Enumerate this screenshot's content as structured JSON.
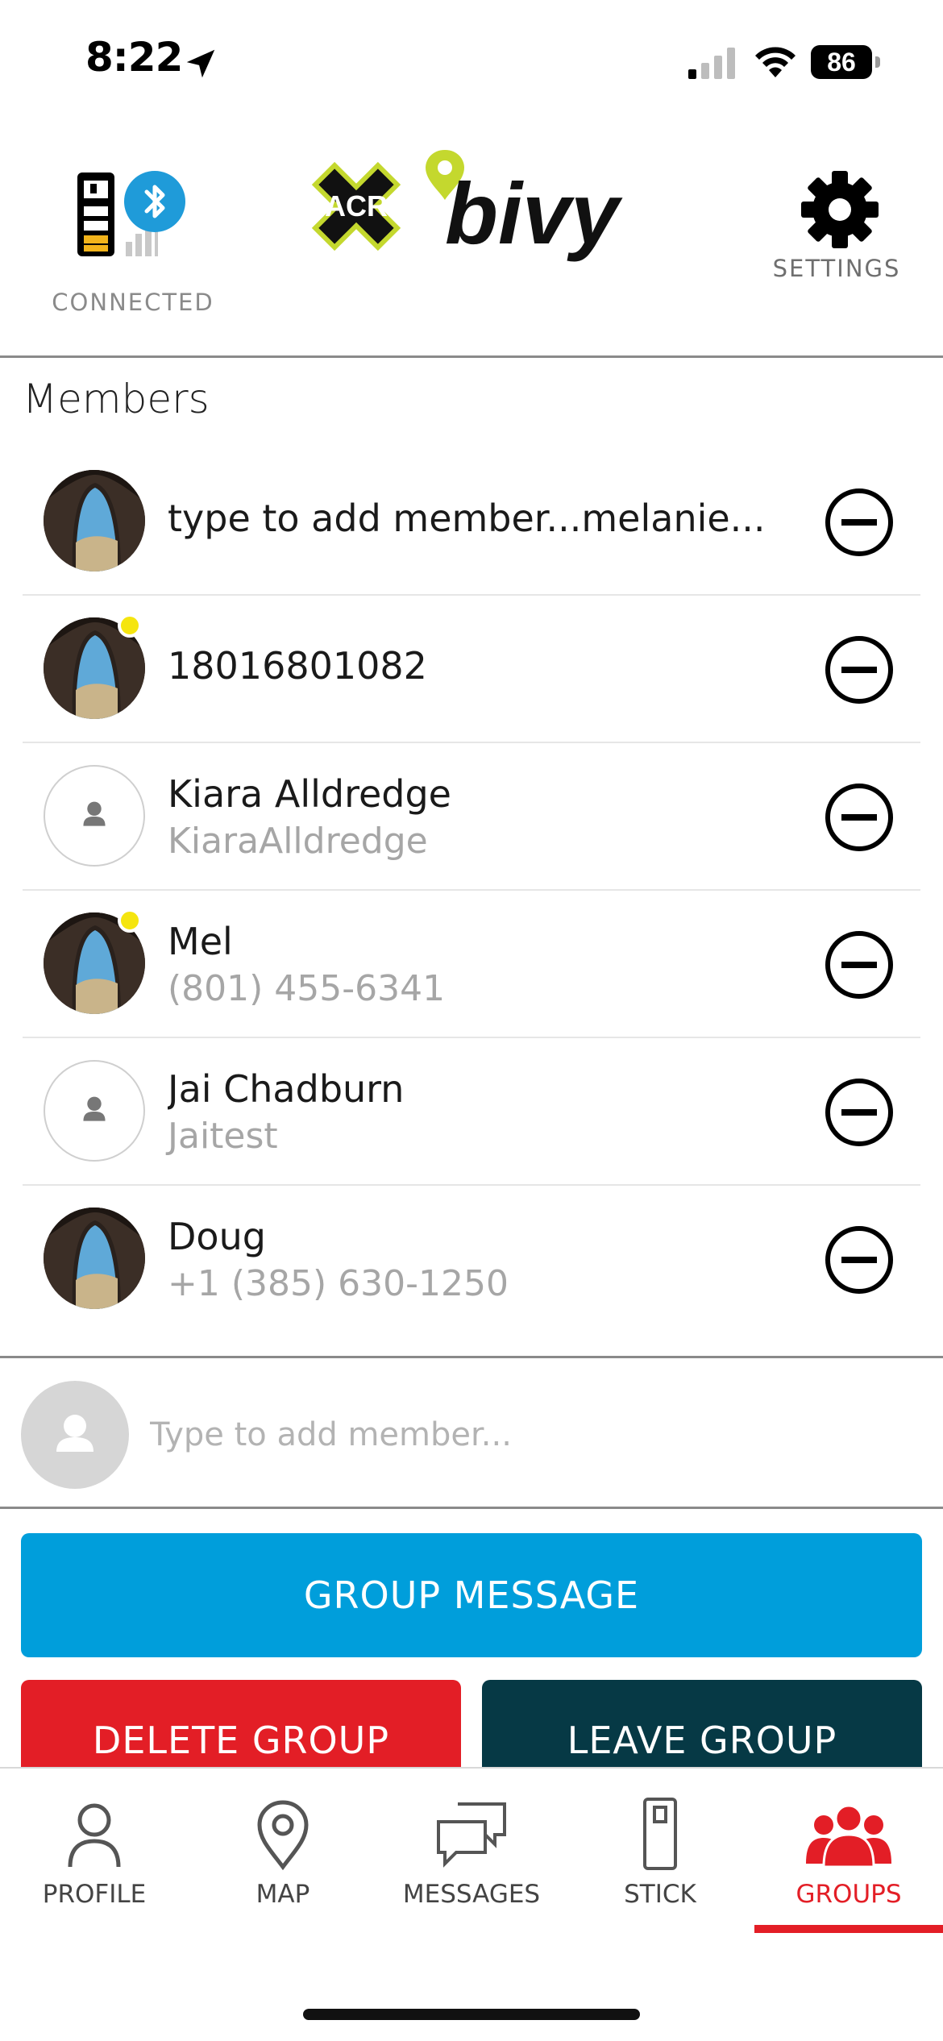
{
  "status_bar": {
    "time": "8:22",
    "battery": "86"
  },
  "header": {
    "connection_label": "CONNECTED",
    "logo_text": "ACR bivy",
    "settings_label": "SETTINGS"
  },
  "members_section": {
    "title": "Members",
    "members": [
      {
        "name": "type to add member...melanie...",
        "sub": "",
        "avatar": "photo",
        "online": false
      },
      {
        "name": "18016801082",
        "sub": "",
        "avatar": "photo",
        "online": true
      },
      {
        "name": "Kiara Alldredge",
        "sub": "KiaraAlldredge",
        "avatar": "placeholder",
        "online": false
      },
      {
        "name": "Mel",
        "sub": "(801) 455-6341",
        "avatar": "photo",
        "online": true
      },
      {
        "name": "Jai Chadburn",
        "sub": "Jaitest",
        "avatar": "placeholder",
        "online": false
      },
      {
        "name": "Doug",
        "sub": "+1 (385) 630-1250",
        "avatar": "photo",
        "online": false
      }
    ]
  },
  "add_member": {
    "placeholder": "Type to add member..."
  },
  "actions": {
    "group_message": "GROUP MESSAGE",
    "delete_group": "DELETE GROUP",
    "leave_group": "LEAVE GROUP"
  },
  "tab_bar": {
    "tabs": [
      {
        "label": "PROFILE",
        "icon": "person-icon"
      },
      {
        "label": "MAP",
        "icon": "map-pin-icon"
      },
      {
        "label": "MESSAGES",
        "icon": "chat-bubbles-icon"
      },
      {
        "label": "STICK",
        "icon": "device-stick-icon"
      },
      {
        "label": "GROUPS",
        "icon": "group-icon",
        "active": true
      }
    ]
  },
  "colors": {
    "accent_blue": "#009edb",
    "danger_red": "#e31e26",
    "dark_teal": "#063945",
    "online_yellow": "#f5e50f",
    "logo_lime": "#c4d82e"
  }
}
